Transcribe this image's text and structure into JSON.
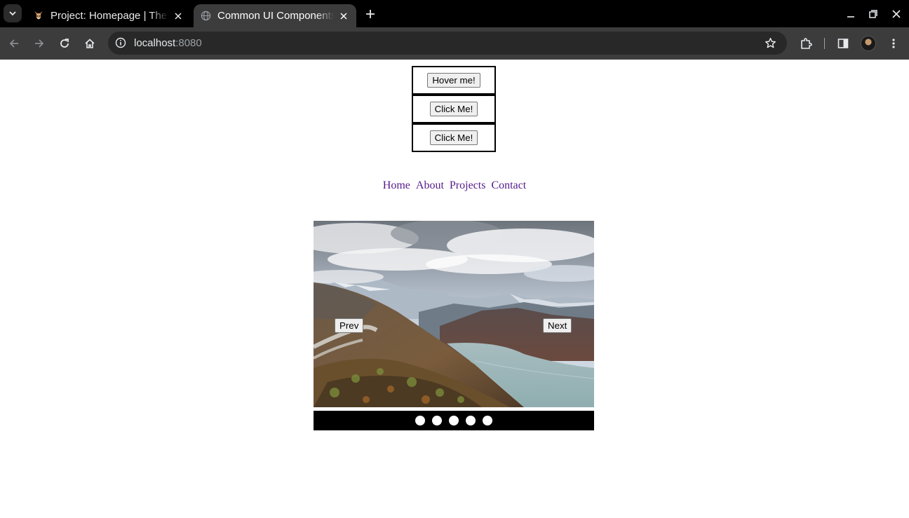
{
  "browser": {
    "tabs": [
      {
        "title": "Project: Homepage | The Odin Project",
        "active": false,
        "favicon": "odin-favicon-icon"
      },
      {
        "title": "Common UI Components",
        "active": true,
        "favicon": "globe-icon"
      }
    ],
    "address": {
      "host": "localhost",
      "port": ":8080"
    }
  },
  "page": {
    "hover_button": {
      "label": "Hover me!"
    },
    "click_buttons": [
      {
        "label": "Click Me!"
      },
      {
        "label": "Click Me!"
      }
    ],
    "nav": {
      "links": [
        {
          "label": "Home"
        },
        {
          "label": "About"
        },
        {
          "label": "Projects"
        },
        {
          "label": "Contact"
        }
      ],
      "link_color": "#551a8b"
    },
    "carousel": {
      "prev_label": "Prev",
      "next_label": "Next",
      "slide_count": 5,
      "image": "mountain-lake-landscape"
    }
  }
}
